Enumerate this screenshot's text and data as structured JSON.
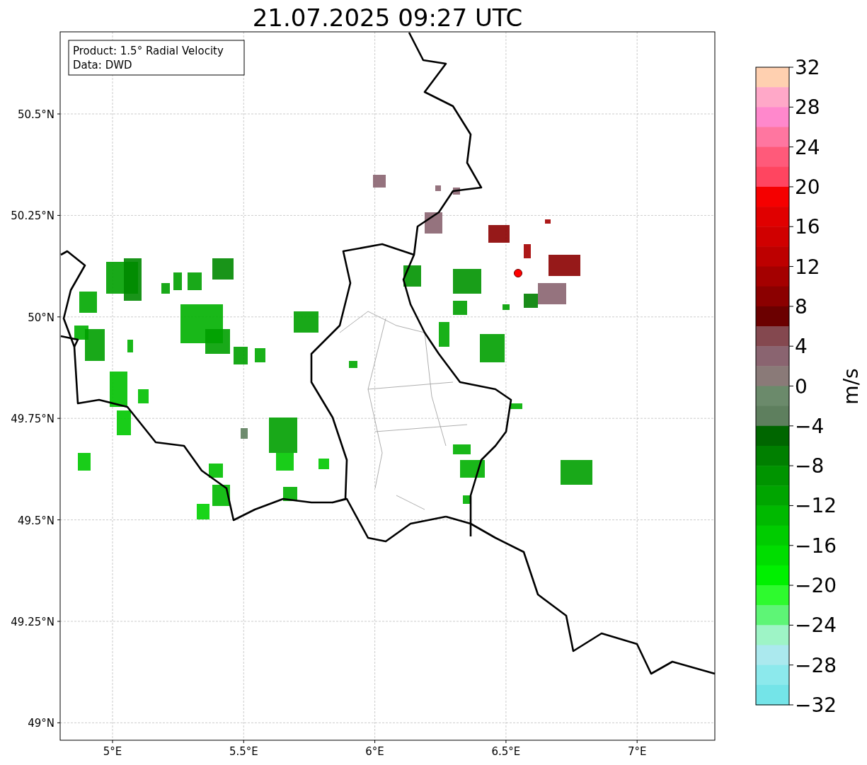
{
  "title": "21.07.2025 09:27 UTC",
  "info_box": [
    "Product: 1.5° Radial Velocity",
    "Data: DWD"
  ],
  "y_ticks": [
    "50.5°N",
    "50.25°N",
    "50°N",
    "49.75°N",
    "49.5°N",
    "49.25°N",
    "49°N"
  ],
  "x_ticks": [
    "5°E",
    "5.5°E",
    "6°E",
    "6.5°E",
    "7°E"
  ],
  "colorbar": {
    "label": "m/s",
    "ticks": [
      "32",
      "28",
      "24",
      "20",
      "16",
      "12",
      "8",
      "4",
      "0",
      "−4",
      "−8",
      "−12",
      "−16",
      "−20",
      "−24",
      "−28",
      "−32"
    ],
    "bands": [
      {
        "color": "#ffd0b0"
      },
      {
        "color": "#ffa8c8"
      },
      {
        "color": "#ff88cc"
      },
      {
        "color": "#ff76a0"
      },
      {
        "color": "#ff5a7a"
      },
      {
        "color": "#ff4560"
      },
      {
        "color": "#f50000"
      },
      {
        "color": "#e00000"
      },
      {
        "color": "#d00000"
      },
      {
        "color": "#bd0000"
      },
      {
        "color": "#a40000"
      },
      {
        "color": "#8b0000"
      },
      {
        "color": "#6b0000"
      },
      {
        "color": "#84484f"
      },
      {
        "color": "#8a6470"
      },
      {
        "color": "#8a7a78"
      },
      {
        "color": "#6b8a6b"
      },
      {
        "color": "#5e7f5e"
      },
      {
        "color": "#006600"
      },
      {
        "color": "#007f00"
      },
      {
        "color": "#009400"
      },
      {
        "color": "#00a500"
      },
      {
        "color": "#00b900"
      },
      {
        "color": "#00cc00"
      },
      {
        "color": "#00dd00"
      },
      {
        "color": "#00f000"
      },
      {
        "color": "#2efa2e"
      },
      {
        "color": "#5ef576"
      },
      {
        "color": "#9ef4c6"
      },
      {
        "color": "#abe9ee"
      },
      {
        "color": "#8ce9ec"
      },
      {
        "color": "#74e4e8"
      }
    ]
  }
}
